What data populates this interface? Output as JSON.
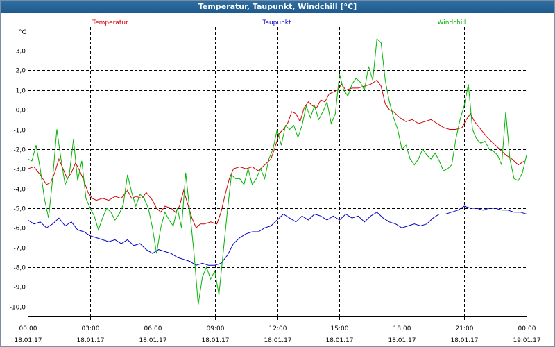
{
  "window": {
    "title": "Temperatur, Taupunkt, Windchill [°C]"
  },
  "chart_data": {
    "type": "line",
    "title": "Temperatur, Taupunkt, Windchill [°C]",
    "ylabel": "°C",
    "ylim": [
      -10.5,
      4.2
    ],
    "xlim": [
      0,
      24
    ],
    "grid": true,
    "legend_placement": "top",
    "y_ticks": [
      3,
      2,
      1,
      0,
      -1,
      -2,
      -3,
      -4,
      -5,
      -6,
      -7,
      -8,
      -9,
      -10
    ],
    "y_tick_labels": [
      "3,0",
      "2,0",
      "1,0",
      "0,0",
      "-1,0",
      "-2,0",
      "-3,0",
      "-4,0",
      "-5,0",
      "-6,0",
      "-7,0",
      "-8,0",
      "-9,0",
      "-10,0"
    ],
    "x_ticks": [
      0,
      3,
      6,
      9,
      12,
      15,
      18,
      21,
      24
    ],
    "x_tick_labels": [
      [
        "00:00",
        "18.01.17"
      ],
      [
        "03:00",
        "18.01.17"
      ],
      [
        "06:00",
        "18.01.17"
      ],
      [
        "09:00",
        "18.01.17"
      ],
      [
        "12:00",
        "18.01.17"
      ],
      [
        "15:00",
        "18.01.17"
      ],
      [
        "18:00",
        "18.01.17"
      ],
      [
        "21:00",
        "18.01.17"
      ],
      [
        "00:00",
        "19.01.17"
      ]
    ],
    "series": [
      {
        "name": "Temperatur",
        "color": "#d40000",
        "points": [
          [
            0,
            -3.0
          ],
          [
            0.3,
            -2.9
          ],
          [
            0.6,
            -3.3
          ],
          [
            0.9,
            -3.8
          ],
          [
            1.1,
            -3.7
          ],
          [
            1.3,
            -3.2
          ],
          [
            1.5,
            -2.5
          ],
          [
            1.7,
            -3.0
          ],
          [
            1.9,
            -3.5
          ],
          [
            2.1,
            -3.2
          ],
          [
            2.3,
            -2.7
          ],
          [
            2.5,
            -3.1
          ],
          [
            2.7,
            -3.6
          ],
          [
            2.9,
            -4.2
          ],
          [
            3.1,
            -4.5
          ],
          [
            3.3,
            -4.6
          ],
          [
            3.6,
            -4.5
          ],
          [
            3.9,
            -4.6
          ],
          [
            4.2,
            -4.4
          ],
          [
            4.5,
            -4.5
          ],
          [
            4.8,
            -4.1
          ],
          [
            5.0,
            -4.5
          ],
          [
            5.2,
            -4.4
          ],
          [
            5.5,
            -4.5
          ],
          [
            5.7,
            -4.2
          ],
          [
            6.0,
            -4.6
          ],
          [
            6.2,
            -5.0
          ],
          [
            6.4,
            -5.2
          ],
          [
            6.6,
            -4.9
          ],
          [
            6.9,
            -5.0
          ],
          [
            7.1,
            -5.2
          ],
          [
            7.3,
            -4.9
          ],
          [
            7.5,
            -4.1
          ],
          [
            7.7,
            -4.8
          ],
          [
            7.9,
            -5.5
          ],
          [
            8.1,
            -6.0
          ],
          [
            8.3,
            -5.8
          ],
          [
            8.5,
            -5.8
          ],
          [
            8.8,
            -5.7
          ],
          [
            9.1,
            -5.8
          ],
          [
            9.3,
            -5.2
          ],
          [
            9.5,
            -4.3
          ],
          [
            9.7,
            -3.5
          ],
          [
            9.9,
            -3.0
          ],
          [
            10.2,
            -2.9
          ],
          [
            10.5,
            -3.0
          ],
          [
            10.8,
            -2.9
          ],
          [
            11.1,
            -3.1
          ],
          [
            11.4,
            -2.8
          ],
          [
            11.7,
            -2.5
          ],
          [
            11.9,
            -1.9
          ],
          [
            12.1,
            -1.2
          ],
          [
            12.3,
            -1.0
          ],
          [
            12.5,
            -0.7
          ],
          [
            12.7,
            -0.1
          ],
          [
            12.9,
            -0.2
          ],
          [
            13.1,
            -0.6
          ],
          [
            13.3,
            0.1
          ],
          [
            13.5,
            0.4
          ],
          [
            13.7,
            0.2
          ],
          [
            13.9,
            0.1
          ],
          [
            14.1,
            0.5
          ],
          [
            14.3,
            0.4
          ],
          [
            14.5,
            0.8
          ],
          [
            14.7,
            0.9
          ],
          [
            14.9,
            1.0
          ],
          [
            15.1,
            1.3
          ],
          [
            15.3,
            1.0
          ],
          [
            15.6,
            1.1
          ],
          [
            15.9,
            1.1
          ],
          [
            16.2,
            1.2
          ],
          [
            16.5,
            1.3
          ],
          [
            16.8,
            1.5
          ],
          [
            17.0,
            1.2
          ],
          [
            17.2,
            0.3
          ],
          [
            17.4,
            0.0
          ],
          [
            17.6,
            -0.1
          ],
          [
            17.9,
            -0.4
          ],
          [
            18.2,
            -0.6
          ],
          [
            18.5,
            -0.5
          ],
          [
            18.8,
            -0.7
          ],
          [
            19.1,
            -0.6
          ],
          [
            19.4,
            -0.5
          ],
          [
            19.7,
            -0.7
          ],
          [
            20.0,
            -0.9
          ],
          [
            20.3,
            -1.0
          ],
          [
            20.6,
            -1.0
          ],
          [
            20.9,
            -0.9
          ],
          [
            21.1,
            -0.5
          ],
          [
            21.3,
            -0.2
          ],
          [
            21.5,
            -0.6
          ],
          [
            21.8,
            -1.0
          ],
          [
            22.1,
            -1.4
          ],
          [
            22.4,
            -1.7
          ],
          [
            22.7,
            -2.0
          ],
          [
            23.0,
            -2.3
          ],
          [
            23.3,
            -2.5
          ],
          [
            23.6,
            -2.8
          ],
          [
            23.9,
            -2.6
          ]
        ]
      },
      {
        "name": "Taupunkt",
        "color": "#0000c8",
        "points": [
          [
            0,
            -5.6
          ],
          [
            0.3,
            -5.8
          ],
          [
            0.6,
            -5.7
          ],
          [
            0.9,
            -6.0
          ],
          [
            1.2,
            -5.8
          ],
          [
            1.5,
            -5.5
          ],
          [
            1.8,
            -5.9
          ],
          [
            2.1,
            -5.7
          ],
          [
            2.4,
            -6.1
          ],
          [
            2.7,
            -6.2
          ],
          [
            3.0,
            -6.4
          ],
          [
            3.3,
            -6.5
          ],
          [
            3.6,
            -6.6
          ],
          [
            3.9,
            -6.7
          ],
          [
            4.2,
            -6.6
          ],
          [
            4.5,
            -6.8
          ],
          [
            4.8,
            -6.6
          ],
          [
            5.1,
            -6.9
          ],
          [
            5.4,
            -6.8
          ],
          [
            5.7,
            -7.1
          ],
          [
            6.0,
            -7.3
          ],
          [
            6.3,
            -7.1
          ],
          [
            6.6,
            -7.2
          ],
          [
            6.9,
            -7.3
          ],
          [
            7.2,
            -7.5
          ],
          [
            7.5,
            -7.6
          ],
          [
            7.8,
            -7.7
          ],
          [
            8.1,
            -7.9
          ],
          [
            8.4,
            -7.8
          ],
          [
            8.7,
            -7.9
          ],
          [
            9.0,
            -7.9
          ],
          [
            9.3,
            -7.8
          ],
          [
            9.6,
            -7.4
          ],
          [
            9.9,
            -6.8
          ],
          [
            10.2,
            -6.5
          ],
          [
            10.5,
            -6.3
          ],
          [
            10.8,
            -6.2
          ],
          [
            11.1,
            -6.2
          ],
          [
            11.4,
            -6.0
          ],
          [
            11.7,
            -5.9
          ],
          [
            12.0,
            -5.6
          ],
          [
            12.3,
            -5.3
          ],
          [
            12.6,
            -5.5
          ],
          [
            12.9,
            -5.7
          ],
          [
            13.2,
            -5.4
          ],
          [
            13.5,
            -5.6
          ],
          [
            13.8,
            -5.3
          ],
          [
            14.1,
            -5.4
          ],
          [
            14.4,
            -5.6
          ],
          [
            14.7,
            -5.4
          ],
          [
            15.0,
            -5.6
          ],
          [
            15.3,
            -5.3
          ],
          [
            15.6,
            -5.5
          ],
          [
            15.9,
            -5.4
          ],
          [
            16.2,
            -5.7
          ],
          [
            16.5,
            -5.4
          ],
          [
            16.8,
            -5.2
          ],
          [
            17.1,
            -5.5
          ],
          [
            17.4,
            -5.7
          ],
          [
            17.7,
            -5.8
          ],
          [
            18.0,
            -6.0
          ],
          [
            18.3,
            -5.9
          ],
          [
            18.6,
            -5.8
          ],
          [
            18.9,
            -5.9
          ],
          [
            19.2,
            -5.8
          ],
          [
            19.5,
            -5.5
          ],
          [
            19.8,
            -5.3
          ],
          [
            20.1,
            -5.3
          ],
          [
            20.4,
            -5.2
          ],
          [
            20.7,
            -5.1
          ],
          [
            21.0,
            -4.9
          ],
          [
            21.3,
            -5.0
          ],
          [
            21.6,
            -5.0
          ],
          [
            21.9,
            -5.1
          ],
          [
            22.2,
            -5.0
          ],
          [
            22.5,
            -5.0
          ],
          [
            22.8,
            -5.1
          ],
          [
            23.1,
            -5.1
          ],
          [
            23.4,
            -5.2
          ],
          [
            23.7,
            -5.2
          ],
          [
            24.0,
            -5.3
          ]
        ]
      },
      {
        "name": "Windchill",
        "color": "#00b400",
        "points": [
          [
            0,
            -2.5
          ],
          [
            0.2,
            -2.6
          ],
          [
            0.4,
            -1.8
          ],
          [
            0.6,
            -3.0
          ],
          [
            0.8,
            -4.5
          ],
          [
            1.0,
            -5.5
          ],
          [
            1.2,
            -3.5
          ],
          [
            1.4,
            -1.0
          ],
          [
            1.6,
            -2.5
          ],
          [
            1.8,
            -3.8
          ],
          [
            2.0,
            -3.3
          ],
          [
            2.2,
            -1.5
          ],
          [
            2.4,
            -3.6
          ],
          [
            2.6,
            -2.6
          ],
          [
            2.8,
            -4.5
          ],
          [
            3.0,
            -5.0
          ],
          [
            3.2,
            -5.4
          ],
          [
            3.4,
            -6.1
          ],
          [
            3.6,
            -5.5
          ],
          [
            3.8,
            -5.0
          ],
          [
            4.0,
            -5.2
          ],
          [
            4.2,
            -5.6
          ],
          [
            4.4,
            -5.3
          ],
          [
            4.6,
            -4.8
          ],
          [
            4.8,
            -3.3
          ],
          [
            5.0,
            -4.2
          ],
          [
            5.2,
            -4.9
          ],
          [
            5.4,
            -4.3
          ],
          [
            5.6,
            -4.5
          ],
          [
            5.8,
            -5.0
          ],
          [
            6.0,
            -6.0
          ],
          [
            6.2,
            -7.3
          ],
          [
            6.4,
            -6.0
          ],
          [
            6.6,
            -5.2
          ],
          [
            6.8,
            -5.6
          ],
          [
            7.0,
            -5.9
          ],
          [
            7.2,
            -5.0
          ],
          [
            7.4,
            -6.0
          ],
          [
            7.6,
            -3.2
          ],
          [
            7.8,
            -5.2
          ],
          [
            8.0,
            -7.3
          ],
          [
            8.2,
            -9.9
          ],
          [
            8.4,
            -8.5
          ],
          [
            8.6,
            -8.0
          ],
          [
            8.8,
            -8.6
          ],
          [
            9.0,
            -8.2
          ],
          [
            9.2,
            -9.4
          ],
          [
            9.4,
            -7.3
          ],
          [
            9.6,
            -5.2
          ],
          [
            9.8,
            -3.3
          ],
          [
            10.0,
            -3.5
          ],
          [
            10.2,
            -3.5
          ],
          [
            10.4,
            -3.8
          ],
          [
            10.6,
            -3.0
          ],
          [
            10.8,
            -3.8
          ],
          [
            11.0,
            -3.5
          ],
          [
            11.2,
            -3.0
          ],
          [
            11.4,
            -3.5
          ],
          [
            11.6,
            -2.5
          ],
          [
            11.8,
            -2.0
          ],
          [
            12.0,
            -1.0
          ],
          [
            12.2,
            -1.8
          ],
          [
            12.4,
            -0.8
          ],
          [
            12.6,
            -1.0
          ],
          [
            12.8,
            -0.8
          ],
          [
            13.0,
            -1.4
          ],
          [
            13.2,
            -0.8
          ],
          [
            13.4,
            0.2
          ],
          [
            13.6,
            -0.4
          ],
          [
            13.8,
            0.2
          ],
          [
            14.0,
            -0.5
          ],
          [
            14.2,
            -0.1
          ],
          [
            14.4,
            0.4
          ],
          [
            14.6,
            -0.7
          ],
          [
            14.8,
            -0.2
          ],
          [
            15.0,
            1.8
          ],
          [
            15.2,
            1.0
          ],
          [
            15.4,
            0.7
          ],
          [
            15.6,
            1.3
          ],
          [
            15.8,
            1.6
          ],
          [
            16.0,
            1.4
          ],
          [
            16.2,
            1.0
          ],
          [
            16.4,
            2.2
          ],
          [
            16.6,
            1.5
          ],
          [
            16.8,
            3.6
          ],
          [
            17.0,
            3.4
          ],
          [
            17.2,
            1.5
          ],
          [
            17.4,
            0.4
          ],
          [
            17.6,
            -0.4
          ],
          [
            17.8,
            -1.0
          ],
          [
            18.0,
            -2.0
          ],
          [
            18.2,
            -1.8
          ],
          [
            18.4,
            -2.5
          ],
          [
            18.6,
            -2.8
          ],
          [
            18.8,
            -2.5
          ],
          [
            19.0,
            -2.0
          ],
          [
            19.2,
            -2.3
          ],
          [
            19.4,
            -2.5
          ],
          [
            19.6,
            -2.2
          ],
          [
            19.8,
            -2.6
          ],
          [
            20.0,
            -3.1
          ],
          [
            20.2,
            -3.0
          ],
          [
            20.4,
            -2.8
          ],
          [
            20.6,
            -1.5
          ],
          [
            20.8,
            -0.5
          ],
          [
            21.0,
            0.2
          ],
          [
            21.2,
            1.3
          ],
          [
            21.4,
            -1.0
          ],
          [
            21.6,
            -1.5
          ],
          [
            21.8,
            -1.7
          ],
          [
            22.0,
            -1.6
          ],
          [
            22.2,
            -2.0
          ],
          [
            22.4,
            -2.1
          ],
          [
            22.6,
            -2.3
          ],
          [
            22.8,
            -2.8
          ],
          [
            23.0,
            -0.1
          ],
          [
            23.2,
            -2.5
          ],
          [
            23.4,
            -3.5
          ],
          [
            23.6,
            -3.6
          ],
          [
            23.8,
            -3.2
          ],
          [
            24.0,
            -2.3
          ]
        ]
      }
    ]
  }
}
